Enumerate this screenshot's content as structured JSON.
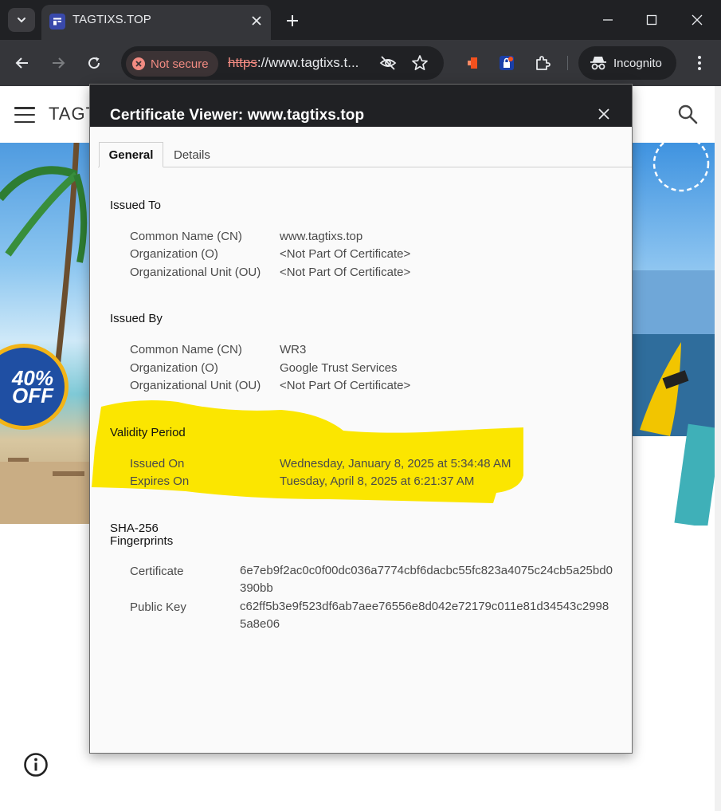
{
  "browser": {
    "tab_title": "TAGTIXS.TOP",
    "security_chip": "Not secure",
    "url_scheme": "https",
    "url_rest": "://www.tagtixs.t...",
    "incognito_label": "Incognito"
  },
  "site": {
    "logo_text": "TAGT",
    "badge_line1": "40%",
    "badge_line2": "OFF"
  },
  "dialog": {
    "title": "Certificate Viewer: www.tagtixs.top",
    "tabs": {
      "general": "General",
      "details": "Details"
    },
    "issued_to": {
      "heading": "Issued To",
      "rows": [
        {
          "label": "Common Name (CN)",
          "value": "www.tagtixs.top"
        },
        {
          "label": "Organization (O)",
          "value": "<Not Part Of Certificate>"
        },
        {
          "label": "Organizational Unit (OU)",
          "value": "<Not Part Of Certificate>"
        }
      ]
    },
    "issued_by": {
      "heading": "Issued By",
      "rows": [
        {
          "label": "Common Name (CN)",
          "value": "WR3"
        },
        {
          "label": "Organization (O)",
          "value": "Google Trust Services"
        },
        {
          "label": "Organizational Unit (OU)",
          "value": "<Not Part Of Certificate>"
        }
      ]
    },
    "validity": {
      "heading": "Validity Period",
      "rows": [
        {
          "label": "Issued On",
          "value": "Wednesday, January 8, 2025 at 5:34:48 AM"
        },
        {
          "label": "Expires On",
          "value": "Tuesday, April 8, 2025 at 6:21:37 AM"
        }
      ]
    },
    "fingerprints": {
      "heading_line1": "SHA-256",
      "heading_line2": "Fingerprints",
      "rows": [
        {
          "label": "Certificate",
          "value": "6e7eb9f2ac0c0f00dc036a7774cbf6dacbc55fc823a4075c24cb5a25bd0390bb"
        },
        {
          "label": "Public Key",
          "value": "c62ff5b3e9f523df6ab7aee76556e8d042e72179c011e81d34543c29985a8e06"
        }
      ]
    }
  },
  "colors": {
    "chrome_dark": "#202124",
    "toolbar": "#35363a",
    "not_secure_red": "#f28b82",
    "highlight_yellow": "#fbe600",
    "dialog_bg": "#fafafa"
  },
  "icons": [
    "tab-search-icon",
    "favicon-icon",
    "close-icon",
    "plus-icon",
    "minimize-icon",
    "maximize-icon",
    "back-icon",
    "forward-icon",
    "reload-icon",
    "error-icon",
    "eye-off-icon",
    "star-icon",
    "extension-icon",
    "puzzle-icon",
    "incognito-icon",
    "kebab-menu-icon",
    "hamburger-icon",
    "search-icon",
    "info-icon"
  ]
}
